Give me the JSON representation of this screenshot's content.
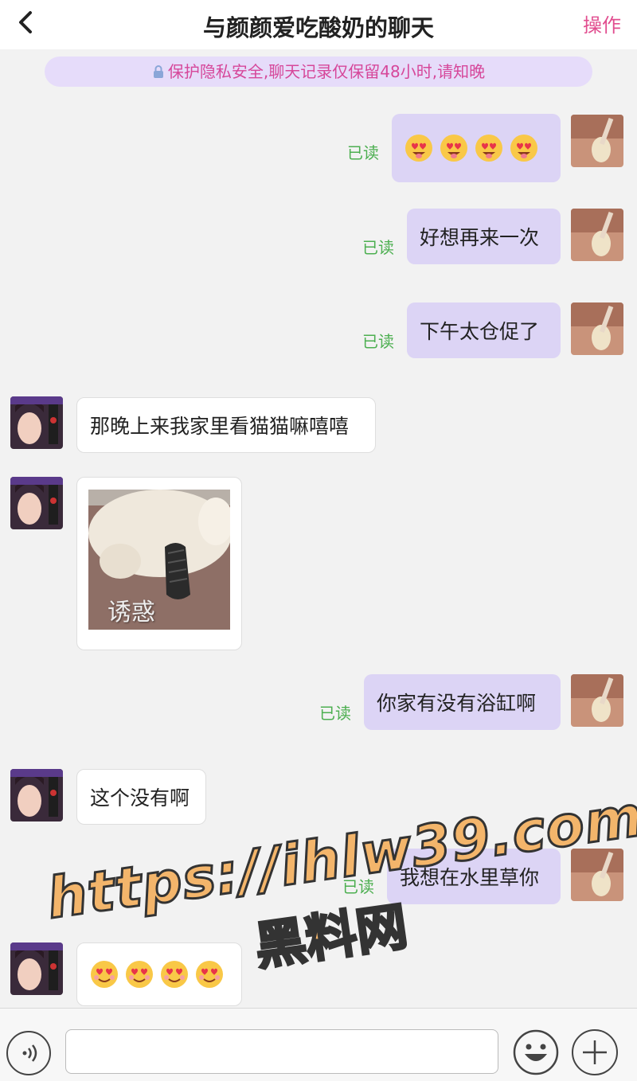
{
  "header": {
    "back_glyph": "‹",
    "title": "与颜颜爱吃酸奶的聊天",
    "action_label": "操作"
  },
  "notice": {
    "text": "保护隐私安全,聊天记录仅保留48小时,请知晚",
    "icon": "lock-icon"
  },
  "messages": [
    {
      "direction": "out",
      "type": "emoji",
      "emoji": [
        "heart-eyes-tongue",
        "heart-eyes-tongue",
        "heart-eyes-tongue",
        "heart-eyes-tongue"
      ],
      "status": "已读"
    },
    {
      "direction": "out",
      "type": "text",
      "text": "好想再来一次",
      "status": "已读"
    },
    {
      "direction": "out",
      "type": "text",
      "text": "下午太仓促了",
      "status": "已读"
    },
    {
      "direction": "in",
      "type": "text",
      "text": "那晚上来我家里看猫猫嘛嘻嘻"
    },
    {
      "direction": "in",
      "type": "image",
      "caption": "诱惑"
    },
    {
      "direction": "out",
      "type": "text",
      "text": "你家有没有浴缸啊",
      "status": "已读"
    },
    {
      "direction": "in",
      "type": "text",
      "text": "这个没有啊"
    },
    {
      "direction": "out",
      "type": "text",
      "text": "我想在水里草你",
      "status": "已读"
    },
    {
      "direction": "in",
      "type": "emoji",
      "emoji": [
        "heart-eyes",
        "heart-eyes",
        "heart-eyes",
        "heart-eyes"
      ]
    }
  ],
  "watermark": {
    "line1": "https://ihlw39.com",
    "line2": "黑料网"
  },
  "input_bar": {
    "voice_icon": "voice-icon",
    "emoji_icon": "smiley-icon",
    "plus_icon": "plus-icon",
    "input_value": ""
  },
  "colors": {
    "accent_pink": "#e14d8f",
    "outgoing_bubble": "#dcd4f5",
    "incoming_bubble": "#ffffff",
    "read_status": "#4caf50",
    "notice_bg": "#e6dcfa"
  }
}
